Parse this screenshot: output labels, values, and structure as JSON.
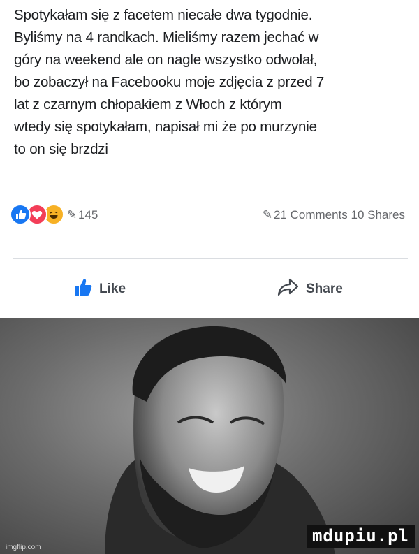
{
  "post": {
    "text": "Spotykałam się z facetem niecałe dwa tygodnie.\nByliśmy na 4 randkach. Mieliśmy razem jechać w\ngóry na weekend ale on nagle wszystko odwołał,\nbo zobaczył na Facebooku moje zdjęcia z przed 7\nlat z czarnym chłopakiem z Włoch z którym\nwtedy się spotykałam, napisał mi że po murzynie\nto on się brzdzi"
  },
  "reactions": {
    "icons": [
      "like-reaction-icon",
      "love-reaction-icon",
      "haha-reaction-icon"
    ],
    "count": "145",
    "comments_stat": "21 Comments 10 Shares"
  },
  "actions": {
    "like_label": "Like",
    "share_label": "Share"
  },
  "image": {
    "watermark_left": "imgflip.com",
    "watermark_right": "mdupiu.pl"
  },
  "colors": {
    "like_blue": "#1877f2",
    "love_red": "#f33e58",
    "haha_yellow": "#f7b125",
    "text": "#1c1e21",
    "meta": "#65676b"
  }
}
